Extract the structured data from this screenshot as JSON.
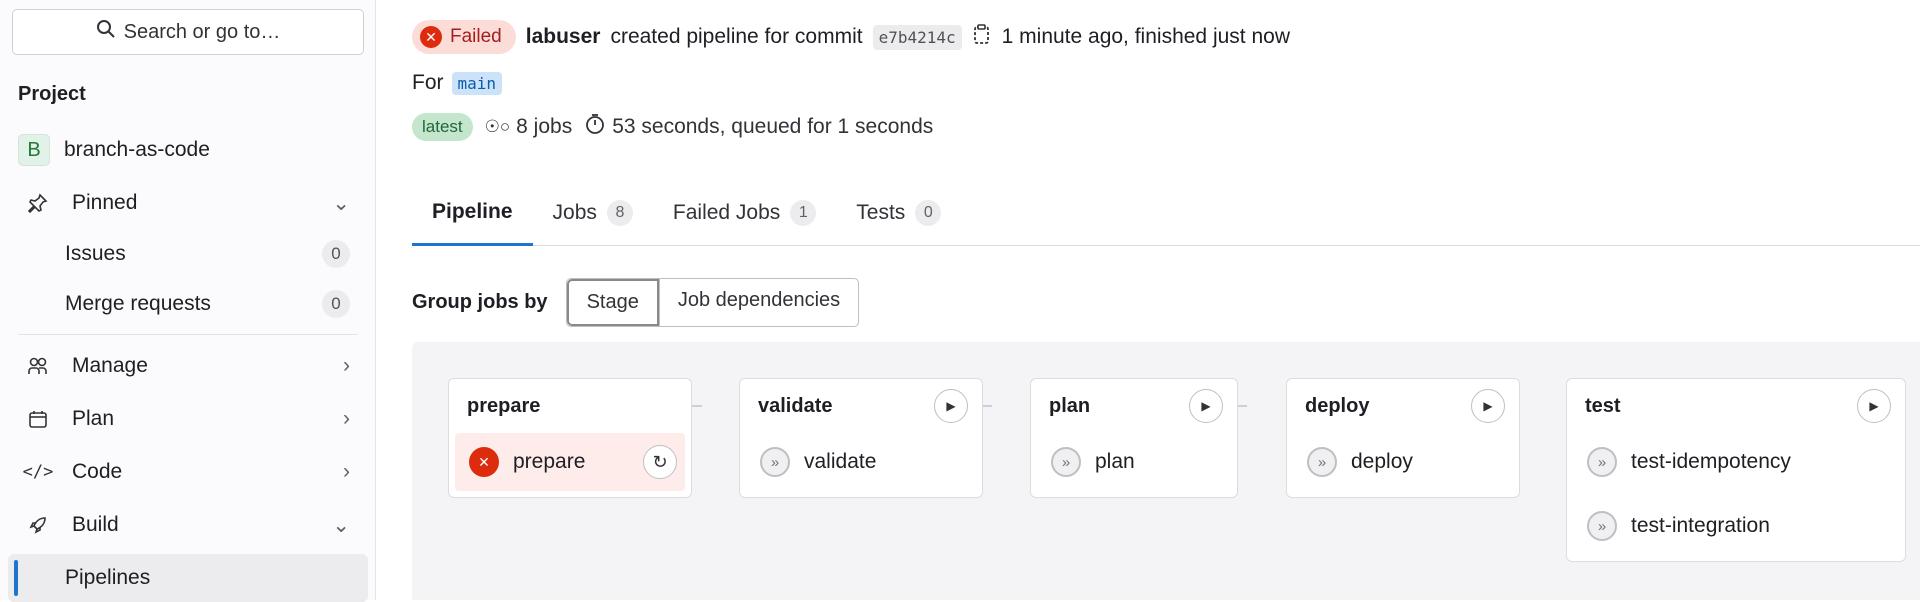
{
  "sidebar": {
    "search_placeholder": "Search or go to…",
    "section_title": "Project",
    "project": {
      "initial": "B",
      "name": "branch-as-code"
    },
    "items": [
      {
        "label": "Pinned"
      },
      {
        "label": "Issues",
        "count": "0"
      },
      {
        "label": "Merge requests",
        "count": "0"
      },
      {
        "label": "Manage"
      },
      {
        "label": "Plan"
      },
      {
        "label": "Code"
      },
      {
        "label": "Build"
      },
      {
        "label": "Pipelines"
      }
    ]
  },
  "header": {
    "status": "Failed",
    "user": "labuser",
    "created_text": "created pipeline for commit",
    "commit": "e7b4214c",
    "time_text": "1 minute ago, finished just now",
    "for_label": "For",
    "branch": "main",
    "latest_badge": "latest",
    "jobs_text": "8 jobs",
    "duration_text": "53 seconds, queued for 1 seconds"
  },
  "tabs": [
    {
      "label": "Pipeline"
    },
    {
      "label": "Jobs",
      "count": "8"
    },
    {
      "label": "Failed Jobs",
      "count": "1"
    },
    {
      "label": "Tests",
      "count": "0"
    }
  ],
  "group_by": {
    "label": "Group jobs by",
    "options": [
      "Stage",
      "Job dependencies"
    ]
  },
  "stages": [
    {
      "name": "prepare",
      "jobs": [
        {
          "name": "prepare",
          "status": "failed"
        }
      ]
    },
    {
      "name": "validate",
      "jobs": [
        {
          "name": "validate",
          "status": "skipped"
        }
      ]
    },
    {
      "name": "plan",
      "jobs": [
        {
          "name": "plan",
          "status": "skipped"
        }
      ]
    },
    {
      "name": "deploy",
      "jobs": [
        {
          "name": "deploy",
          "status": "skipped"
        }
      ]
    },
    {
      "name": "test",
      "jobs": [
        {
          "name": "test-idempotency",
          "status": "skipped"
        },
        {
          "name": "test-integration",
          "status": "skipped"
        }
      ]
    }
  ]
}
